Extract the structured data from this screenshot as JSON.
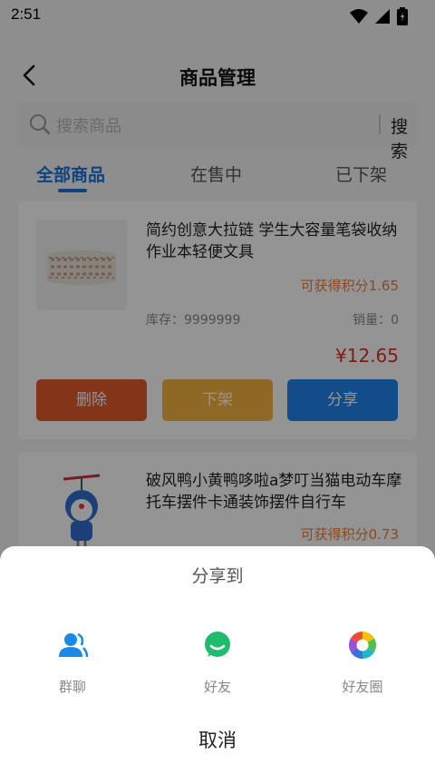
{
  "status_bar": {
    "time": "2:51"
  },
  "header": {
    "title": "商品管理"
  },
  "search": {
    "placeholder": "搜索商品",
    "button_label": "搜索"
  },
  "tabs": [
    {
      "label": "全部商品",
      "active": true
    },
    {
      "label": "在售中",
      "active": false
    },
    {
      "label": "已下架",
      "active": false
    }
  ],
  "products": [
    {
      "name": "简约创意大拉链 学生大容量笔袋收纳作业本轻便文具",
      "points": "可获得积分1.65",
      "stock": "库存：9999999",
      "sales": "销量：0",
      "price": "¥12.65",
      "actions": {
        "delete": "删除",
        "unlist": "下架",
        "share": "分享"
      }
    },
    {
      "name": "破风鸭小黄鸭哆啦a梦叮当猫电动车摩托车摆件卡通装饰摆件自行车",
      "points": "可获得积分0.73"
    }
  ],
  "share_sheet": {
    "title": "分享到",
    "options": [
      {
        "label": "群聊",
        "icon": "group-chat-icon"
      },
      {
        "label": "好友",
        "icon": "friend-chat-icon"
      },
      {
        "label": "好友圈",
        "icon": "moments-icon"
      }
    ],
    "cancel": "取消"
  },
  "colors": {
    "accent": "#1a73d9",
    "delete": "#e45b2a",
    "unlist": "#f5b33f",
    "share": "#1f86ee",
    "price": "#e0301e",
    "points": "#e8813f"
  }
}
